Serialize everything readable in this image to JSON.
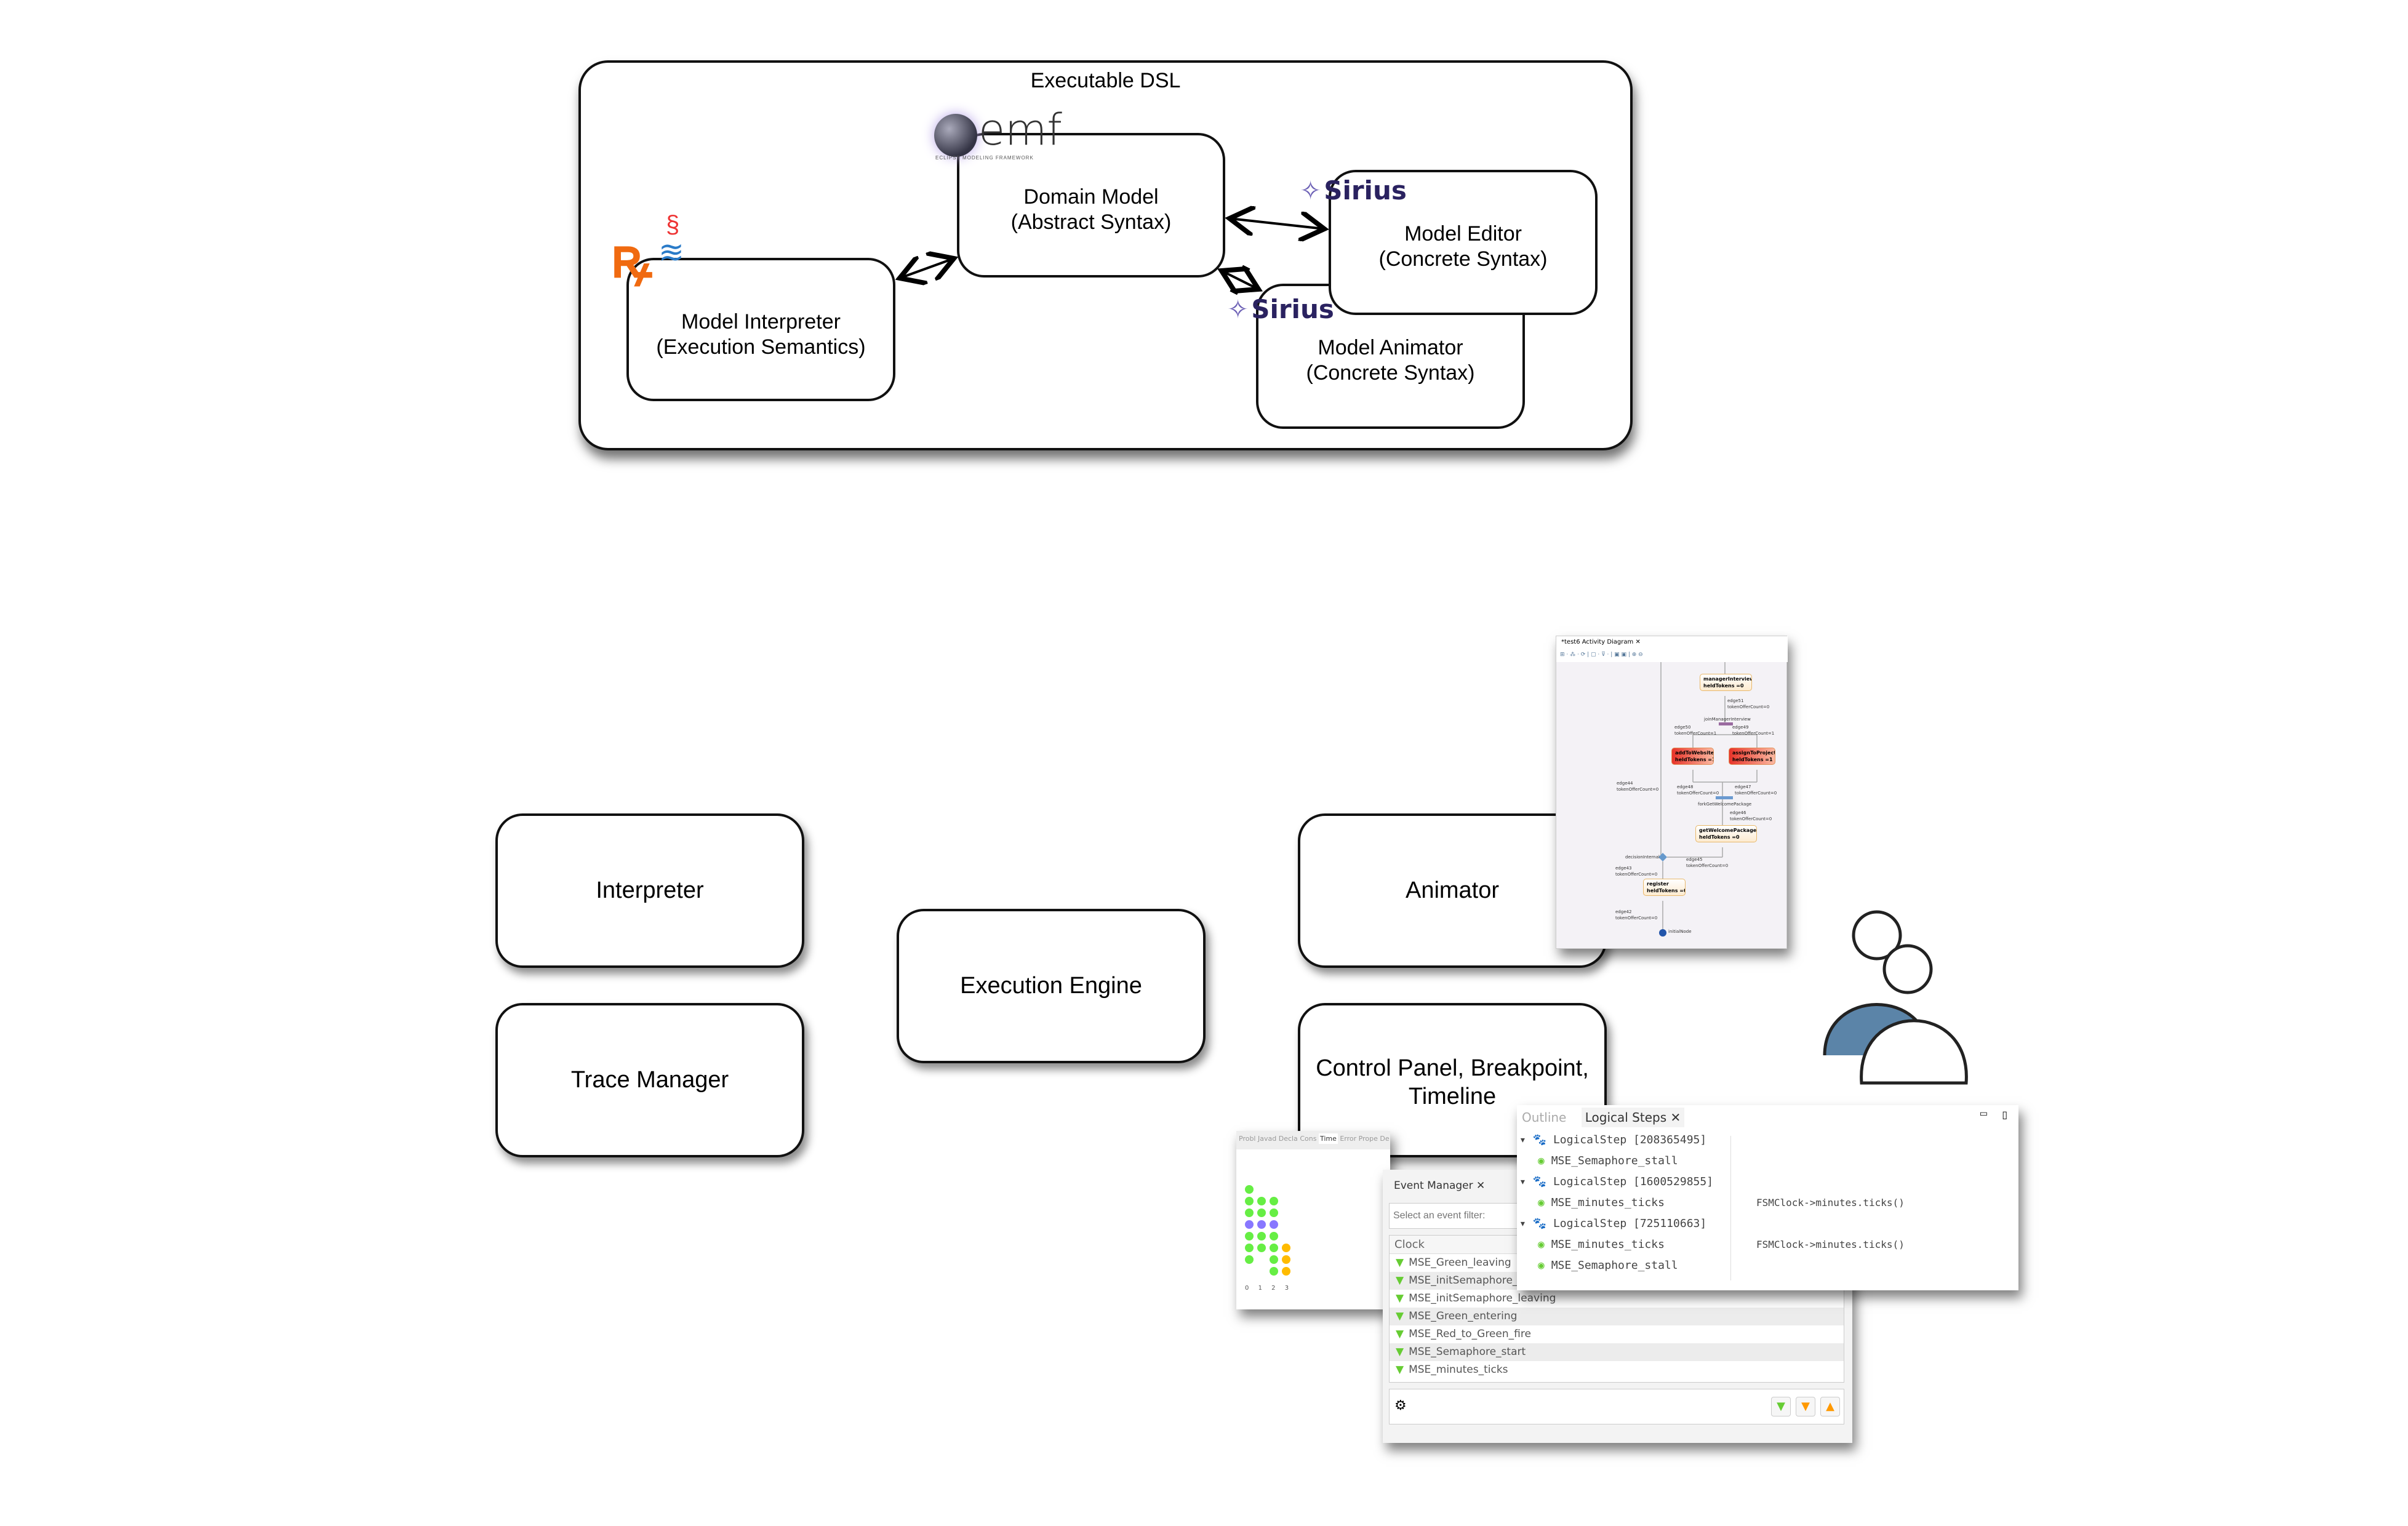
{
  "executable_dsl": {
    "title": "Executable DSL",
    "domain_model": {
      "line1": "Domain Model",
      "line2": "(Abstract Syntax)",
      "logo": "emf",
      "logo_sub": "ECLIPSE MODELING FRAMEWORK"
    },
    "model_editor": {
      "line1": "Model Editor",
      "line2": "(Concrete Syntax)",
      "logo": "Sirius"
    },
    "model_animator": {
      "line1": "Model Animator",
      "line2": "(Concrete Syntax)",
      "logo": "Sirius"
    },
    "model_interpreter": {
      "line1": "Model Interpreter",
      "line2": "(Execution Semantics)",
      "logo_icons": [
        "kermeta-logo",
        "java-logo"
      ]
    }
  },
  "engine": {
    "interpreter": "Interpreter",
    "trace_manager": "Trace Manager",
    "execution_engine": "Execution Engine",
    "animator": "Animator",
    "control_panel": "Control Panel, Breakpoint, Timeline"
  },
  "activity_diagram": {
    "tab": "*test6 Activity Diagram",
    "nodes": {
      "manager": [
        "managerInterview",
        "heldTokens =0"
      ],
      "add": [
        "addToWebsite",
        "heldTokens =1"
      ],
      "assign": [
        "assignToProject",
        "heldTokens =1"
      ],
      "welcome": [
        "getWelcomePackage",
        "heldTokens =0"
      ],
      "register": [
        "register",
        "heldTokens =0"
      ]
    },
    "labels": {
      "edge51": "edge51",
      "edge51c": "tokenOfferCount=0",
      "join": "joinManagerInterview",
      "edge50": "edge50",
      "edge50c": "tokenOfferCount=1",
      "edge49": "edge49",
      "edge49c": "tokenOfferCount=1",
      "edge44": "edge44",
      "edge44c": "tokenOfferCount=0",
      "edge48": "edge48",
      "edge48c": "tokenOfferCount=0",
      "edge47": "edge47",
      "edge47c": "tokenOfferCount=0",
      "fork": "forkGetWelcomePackage",
      "edge46": "edge46",
      "edge46c": "tokenOfferCount=0",
      "decision": "decisionInternal",
      "edge45": "edge45",
      "edge45c": "tokenOfferCount=0",
      "edge43": "edge43",
      "edge43c": "tokenOfferCount=0",
      "edge42": "edge42",
      "edge42c": "tokenOfferCount=0",
      "initial": "initialNode"
    }
  },
  "timeline": {
    "tabs": [
      "Probl",
      "Javad",
      "Decla",
      "Cons",
      "Time",
      "Error",
      "Prope",
      "De"
    ],
    "axis": [
      "0",
      "1",
      "2",
      "3"
    ],
    "colors": {
      "green": "#66ee44",
      "blue": "#8877ff",
      "orange": "#ffbb00"
    }
  },
  "event_manager": {
    "tab": "Event Manager",
    "filter_placeholder": "Select an event filter:",
    "column": "Clock",
    "events": [
      "MSE_Green_leaving",
      "MSE_initSemaphore_entering",
      "MSE_initSemaphore_leaving",
      "MSE_Green_entering",
      "MSE_Red_to_Green_fire",
      "MSE_Semaphore_start",
      "MSE_minutes_ticks"
    ]
  },
  "logical_steps": {
    "tabs": [
      "Outline",
      "Logical Steps"
    ],
    "rows": [
      {
        "label": "LogicalStep [208365495]",
        "detail": ""
      },
      {
        "label": "MSE_Semaphore_stall",
        "detail": ""
      },
      {
        "label": "LogicalStep [1600529855]",
        "detail": ""
      },
      {
        "label": "MSE_minutes_ticks",
        "detail": "FSMClock->minutes.ticks()"
      },
      {
        "label": "LogicalStep [725110663]",
        "detail": ""
      },
      {
        "label": "MSE_minutes_ticks",
        "detail": "FSMClock->minutes.ticks()"
      },
      {
        "label": "MSE_Semaphore_stall",
        "detail": ""
      }
    ]
  }
}
